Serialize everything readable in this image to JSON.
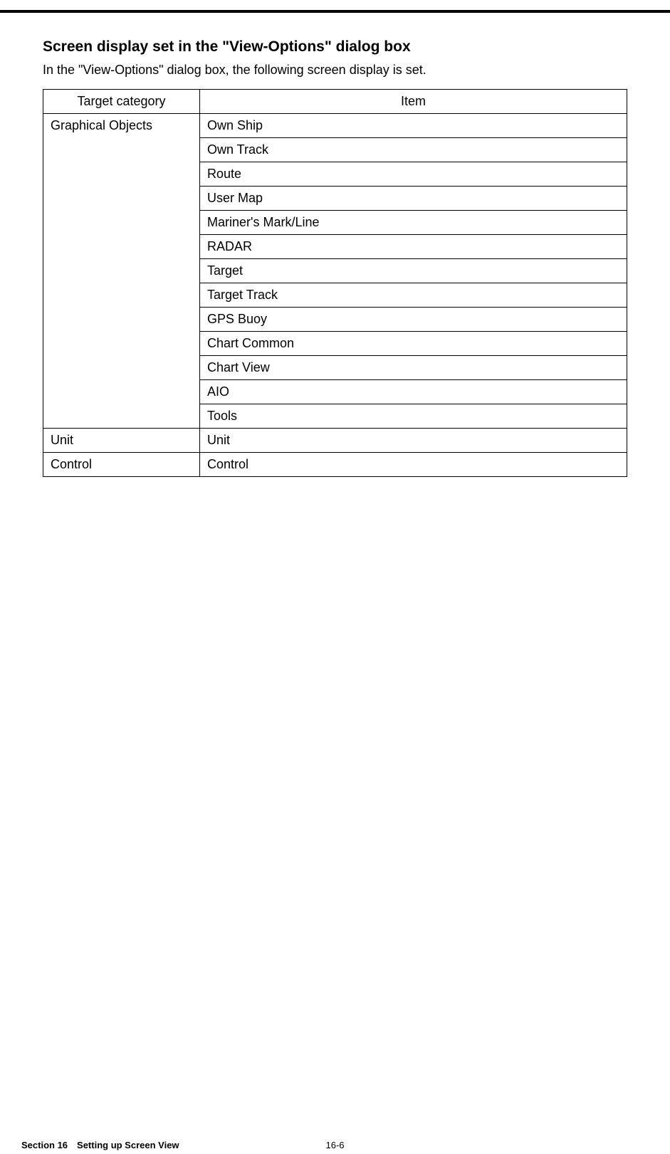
{
  "heading": "Screen display set in the \"View-Options\" dialog box",
  "intro": "In the \"View-Options\" dialog box, the following screen display is set.",
  "table": {
    "headers": {
      "category": "Target category",
      "item": "Item"
    },
    "groups": [
      {
        "category": "Graphical Objects",
        "items": [
          "Own Ship",
          "Own Track",
          "Route",
          "User Map",
          "Mariner's Mark/Line",
          "RADAR",
          "Target",
          "Target Track",
          "GPS Buoy",
          "Chart Common",
          "Chart View",
          "AIO",
          "Tools"
        ]
      },
      {
        "category": "Unit",
        "items": [
          "Unit"
        ]
      },
      {
        "category": "Control",
        "items": [
          "Control"
        ]
      }
    ]
  },
  "footer": {
    "section": "Section 16 Setting up Screen View",
    "page_number": "16-6"
  }
}
